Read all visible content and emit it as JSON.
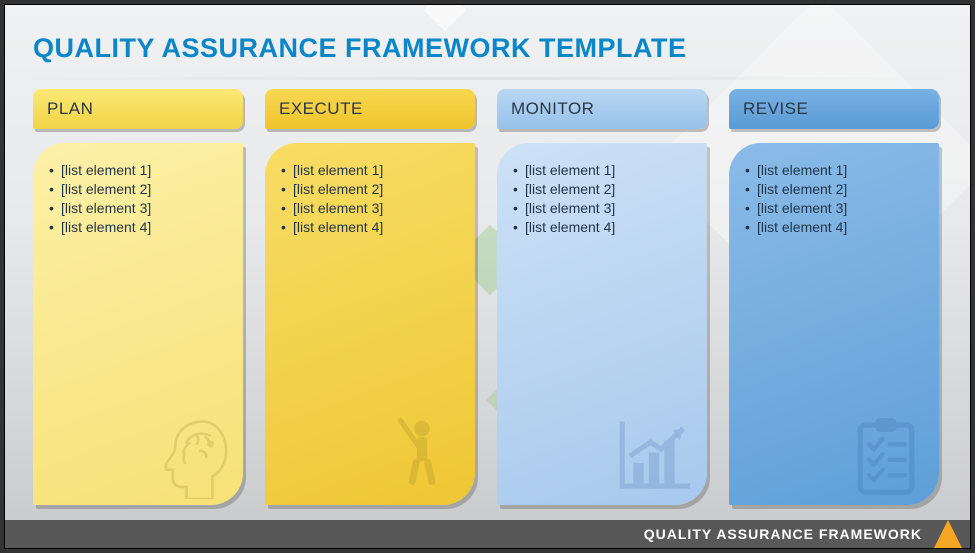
{
  "title": "QUALITY ASSURANCE FRAMEWORK TEMPLATE",
  "footer": "QUALITY ASSURANCE FRAMEWORK",
  "columns": [
    {
      "header": "PLAN",
      "icon": "brain-head-icon",
      "items": [
        "[list element 1]",
        "[list element 2]",
        "[list element 3]",
        "[list element 4]"
      ]
    },
    {
      "header": "EXECUTE",
      "icon": "batter-icon",
      "items": [
        "[list element 1]",
        "[list element 2]",
        "[list element 3]",
        "[list element 4]"
      ]
    },
    {
      "header": "MONITOR",
      "icon": "chart-up-icon",
      "items": [
        "[list element 1]",
        "[list element 2]",
        "[list element 3]",
        "[list element 4]"
      ]
    },
    {
      "header": "REVISE",
      "icon": "clipboard-check-icon",
      "items": [
        "[list element 1]",
        "[list element 2]",
        "[list element 3]",
        "[list element 4]"
      ]
    }
  ]
}
